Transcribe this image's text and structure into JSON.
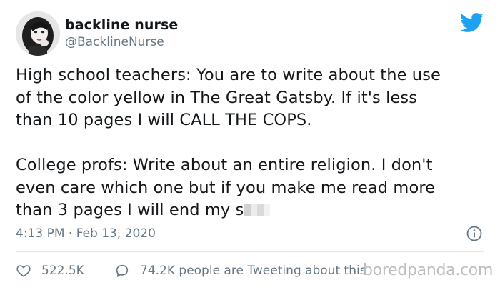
{
  "author": {
    "display_name": "backline nurse",
    "handle": "@BacklineNurse"
  },
  "tweet": {
    "lines": [
      "High school teachers: You are to write about the use",
      "of the color yellow in The Great Gatsby. If it's less",
      "than 10 pages I will CALL THE COPS.",
      "College profs: Write about an entire religion. I don't",
      "even care which one but if you make me read more",
      "than 3 pages I will end my s"
    ],
    "timestamp": "4:13 PM · Feb 13, 2020"
  },
  "actions": {
    "likes_count": "522.5K",
    "retweets_text": "74.2K people are Tweeting about this"
  },
  "watermark": "boredpanda.com",
  "colors": {
    "text": "#14171a",
    "secondary": "#657786",
    "twitter_blue": "#1da1f2",
    "divider": "#e1e8ed"
  },
  "icons": {
    "bird": "twitter-bird-icon",
    "info": "info-icon",
    "like": "heart-icon",
    "reply": "speech-bubble-icon"
  }
}
